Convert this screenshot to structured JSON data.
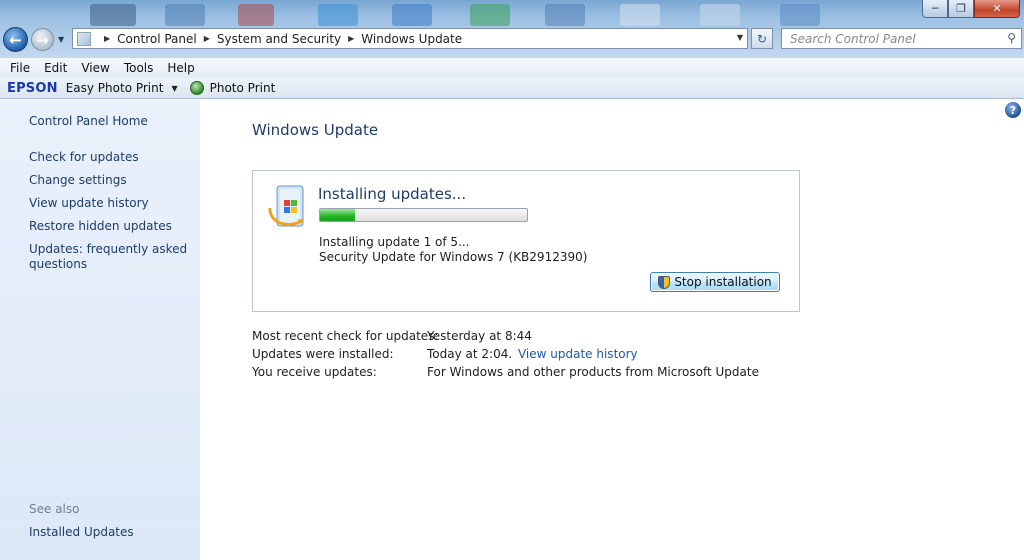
{
  "address_bar": {
    "crumbs": [
      "Control Panel",
      "System and Security",
      "Windows Update"
    ]
  },
  "search": {
    "placeholder": "Search Control Panel"
  },
  "menu": [
    "File",
    "Edit",
    "View",
    "Tools",
    "Help"
  ],
  "toolbar": {
    "brand": "EPSON",
    "easy_photo_print": "Easy Photo Print",
    "photo_print": "Photo Print"
  },
  "sidebar": {
    "home": "Control Panel Home",
    "links": [
      "Check for updates",
      "Change settings",
      "View update history",
      "Restore hidden updates",
      "Updates: frequently asked questions"
    ],
    "see_also_label": "See also",
    "see_also_links": [
      "Installed Updates"
    ]
  },
  "main": {
    "title": "Windows Update",
    "status_heading": "Installing updates...",
    "progress_fraction": 0.17,
    "progress_line": "Installing update 1 of 5...",
    "update_name": "Security Update for Windows 7 (KB2912390)",
    "stop_button": "Stop installation",
    "info": [
      {
        "label": "Most recent check for updates:",
        "value": "Yesterday at 8:44",
        "link": ""
      },
      {
        "label": "Updates were installed:",
        "value": "Today at 2:04.",
        "link": "View update history"
      },
      {
        "label": "You receive updates:",
        "value": "For Windows and other products from Microsoft Update",
        "link": ""
      }
    ]
  },
  "colors": {
    "link": "#1e3c68",
    "heading": "#1e3c68",
    "progress": "#24b528",
    "sidebar_bg": "#e9f1fb"
  },
  "icons": [
    "back-arrow-icon",
    "forward-arrow-icon",
    "control-panel-icon",
    "refresh-icon",
    "search-icon",
    "help-icon",
    "windows-update-icon",
    "uac-shield-icon",
    "photo-print-icon"
  ]
}
